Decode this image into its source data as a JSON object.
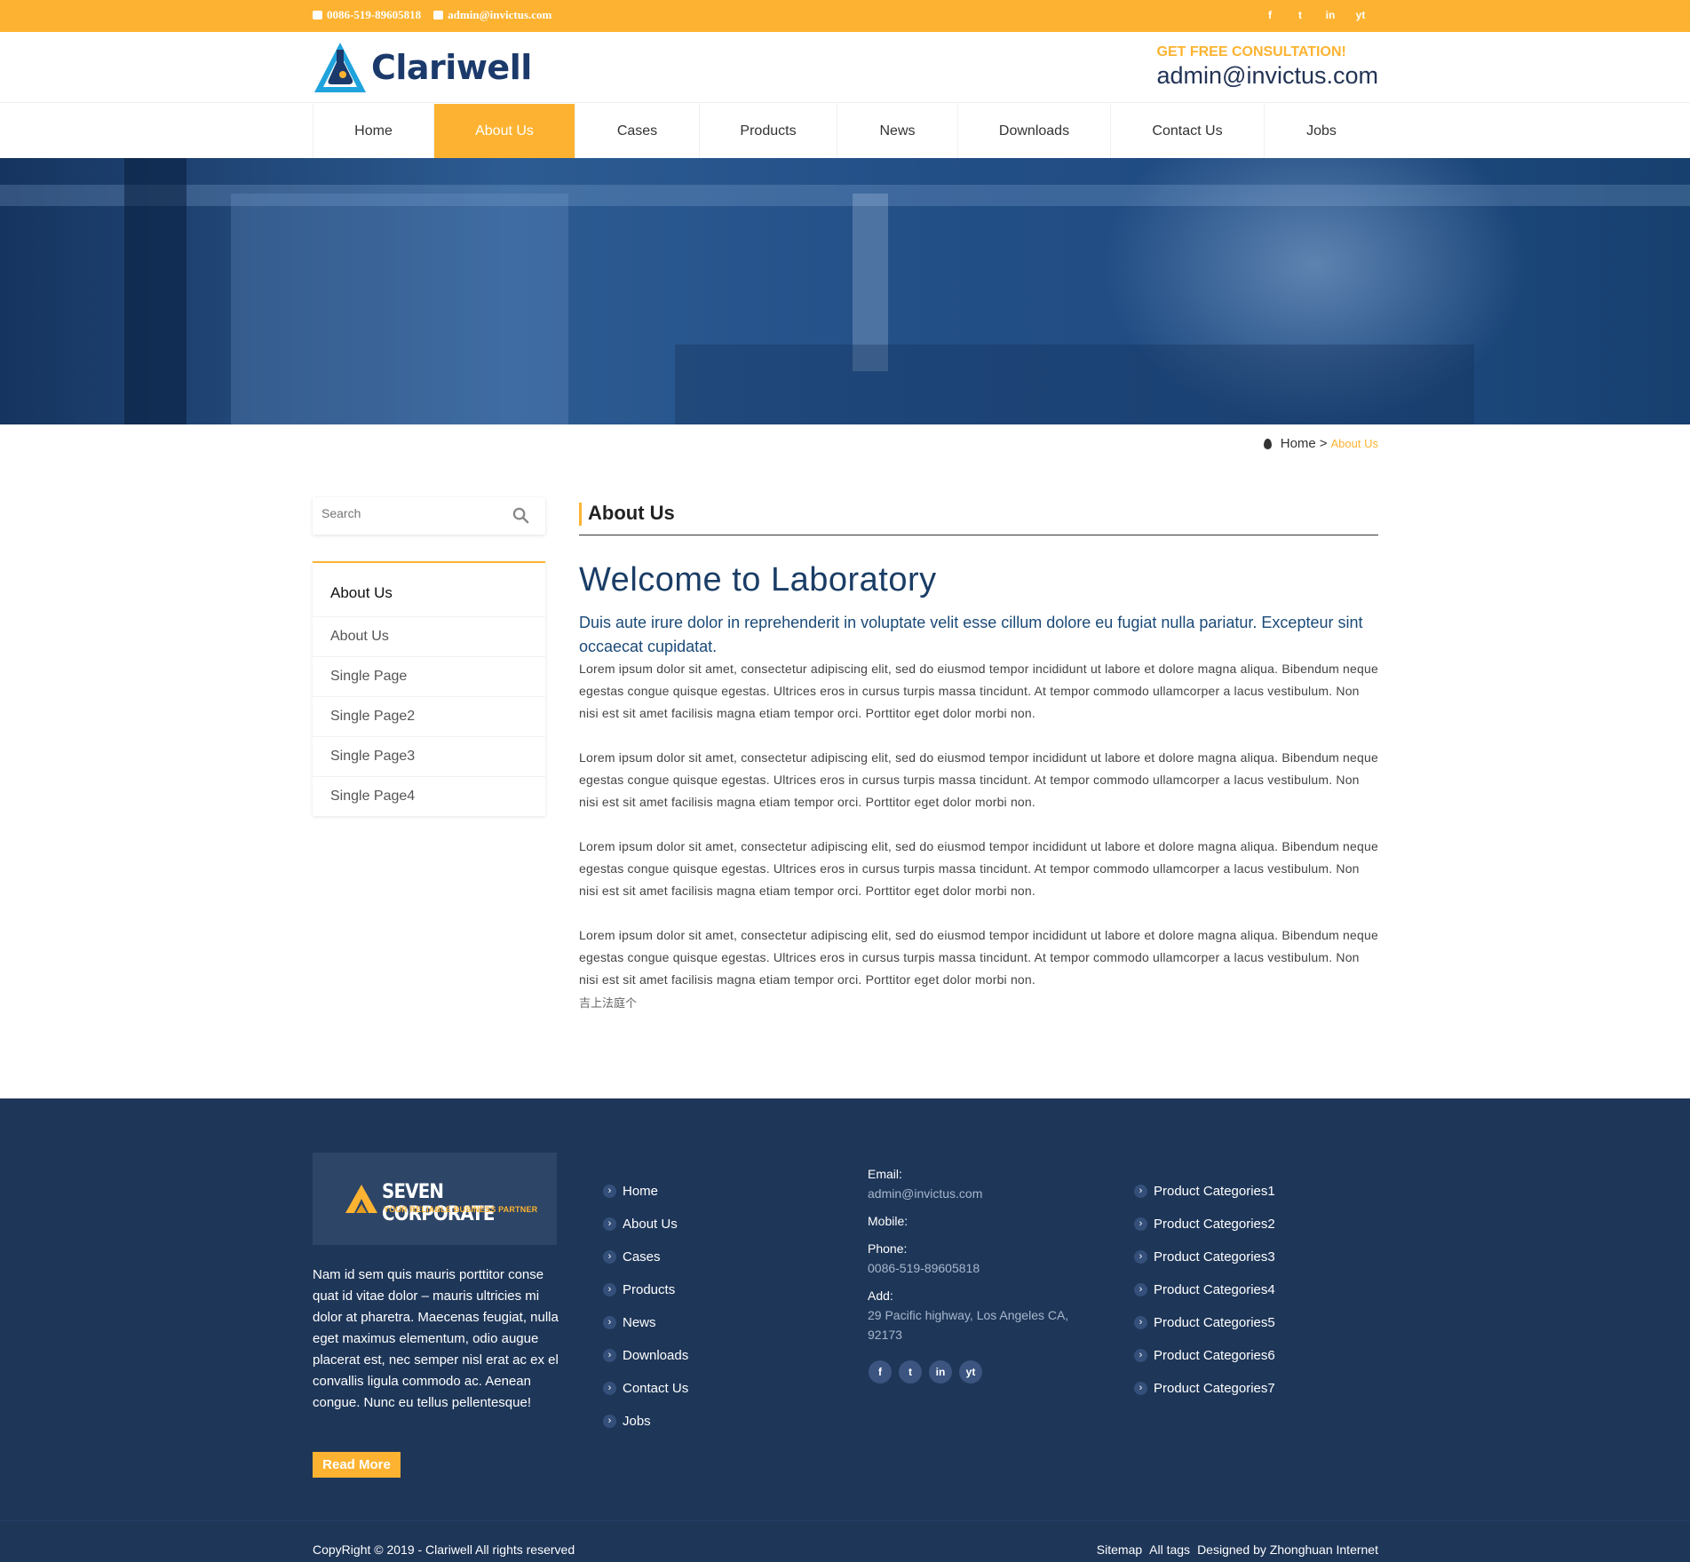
{
  "topbar": {
    "phone": "0086-519-89605818",
    "email": "admin@invictus.com",
    "social": [
      "f",
      "t",
      "in",
      "yt"
    ]
  },
  "header": {
    "logo_text": "Clariwell",
    "consult_label": "GET FREE CONSULTATION!",
    "consult_email": "admin@invictus.com"
  },
  "nav": {
    "items": [
      "Home",
      "About Us",
      "Cases",
      "Products",
      "News",
      "Downloads",
      "Contact Us",
      "Jobs"
    ],
    "active": "About Us"
  },
  "breadcrumb": {
    "home": "Home",
    "separator": ">",
    "current": "About Us"
  },
  "search": {
    "placeholder": "Search"
  },
  "sidebar": {
    "title": "About Us",
    "items": [
      "About Us",
      "Single Page",
      "Single Page2",
      "Single Page3",
      "Single Page4"
    ]
  },
  "main": {
    "section_title": "About Us",
    "heading": "Welcome to Laboratory",
    "lead": "Duis aute irure dolor in reprehenderit in voluptate velit esse cillum dolore eu fugiat nulla pariatur. Excepteur sint occaecat cupidatat.",
    "paragraphs": [
      "Lorem ipsum dolor sit amet, consectetur adipiscing elit, sed do eiusmod tempor incididunt ut labore et dolore magna aliqua. Bibendum neque egestas congue quisque egestas. Ultrices eros in cursus turpis massa tincidunt. At tempor commodo ullamcorper a lacus vestibulum. Non nisi est sit amet facilisis magna etiam tempor orci. Porttitor eget dolor morbi non.",
      "Lorem ipsum dolor sit amet, consectetur adipiscing elit, sed do eiusmod tempor incididunt ut labore et dolore magna aliqua. Bibendum neque egestas congue quisque egestas. Ultrices eros in cursus turpis massa tincidunt. At tempor commodo ullamcorper a lacus vestibulum. Non nisi est sit amet facilisis magna etiam tempor orci. Porttitor eget dolor morbi non.",
      "Lorem ipsum dolor sit amet, consectetur adipiscing elit, sed do eiusmod tempor incididunt ut labore et dolore magna aliqua. Bibendum neque egestas congue quisque egestas. Ultrices eros in cursus turpis massa tincidunt. At tempor commodo ullamcorper a lacus vestibulum. Non nisi est sit amet facilisis magna etiam tempor orci. Porttitor eget dolor morbi non.",
      "Lorem ipsum dolor sit amet, consectetur adipiscing elit, sed do eiusmod tempor incididunt ut labore et dolore magna aliqua. Bibendum neque egestas congue quisque egestas. Ultrices eros in cursus turpis massa tincidunt. At tempor commodo ullamcorper a lacus vestibulum. Non nisi est sit amet facilisis magna etiam tempor orci. Porttitor eget dolor morbi non."
    ],
    "footnote": "吉上法庭个"
  },
  "footer": {
    "logo_title": "SEVEN CORPORATE",
    "logo_tagline": "YOUR RELIABLE BUSINESS PARTNER",
    "about": "Nam id sem quis mauris porttitor conse quat id vitae dolor – mauris ultricies mi dolor at pharetra. Maecenas feugiat, nulla eget maximus elementum, odio augue placerat est, nec semper nisl erat ac ex el convallis ligula commodo ac. Aenean congue. Nunc eu tellus pellentesque!",
    "read_more": "Read More",
    "links": [
      "Home",
      "About Us",
      "Cases",
      "Products",
      "News",
      "Downloads",
      "Contact Us",
      "Jobs"
    ],
    "contact": {
      "email_label": "Email:",
      "email": "admin@invictus.com",
      "mobile_label": "Mobile:",
      "phone_label": "Phone:",
      "phone": "0086-519-89605818",
      "add_label": "Add:",
      "address": "29 Pacific highway, Los Angeles CA, 92173"
    },
    "social": [
      "f",
      "t",
      "in",
      "yt"
    ],
    "categories": [
      "Product Categories1",
      "Product Categories2",
      "Product Categories3",
      "Product Categories4",
      "Product Categories5",
      "Product Categories6",
      "Product Categories7"
    ],
    "copyright": "CopyRight © 2019 -   Clariwell  All rights reserved",
    "bottom_links": [
      "Sitemap",
      "All tags",
      "Designed by Zhonghuan Internet"
    ]
  },
  "colors": {
    "accent": "#fdb331",
    "navy": "#1e3658",
    "brand": "#1b3a6b"
  }
}
